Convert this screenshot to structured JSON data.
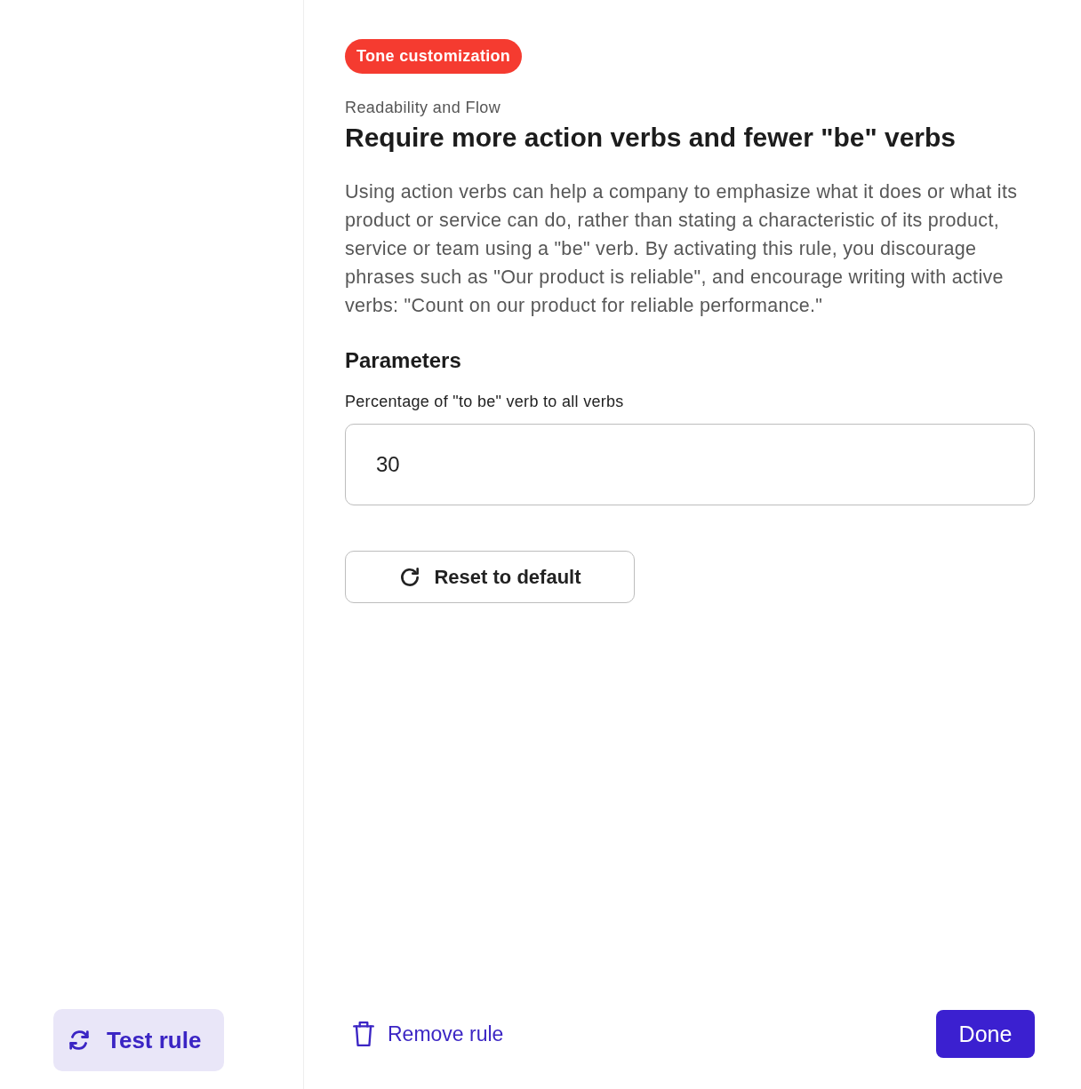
{
  "tag": "Tone customization",
  "category": "Readability and Flow",
  "title": "Require more action verbs and fewer \"be\" verbs",
  "description": "Using action verbs can help a company to emphasize what it does or what its product or service can do, rather than stating a characteristic of its product, service or team using a \"be\" verb. By activating this rule, you discourage phrases such as \"Our product is reliable\", and encourage writing with active verbs: \"Count on our product for reliable performance.\"",
  "parameters": {
    "heading": "Parameters",
    "fields": [
      {
        "label": "Percentage of \"to be\" verb to all verbs",
        "value": "30"
      }
    ]
  },
  "reset_button": "Reset to default",
  "test_button": "Test rule",
  "remove_button": "Remove rule",
  "done_button": "Done"
}
